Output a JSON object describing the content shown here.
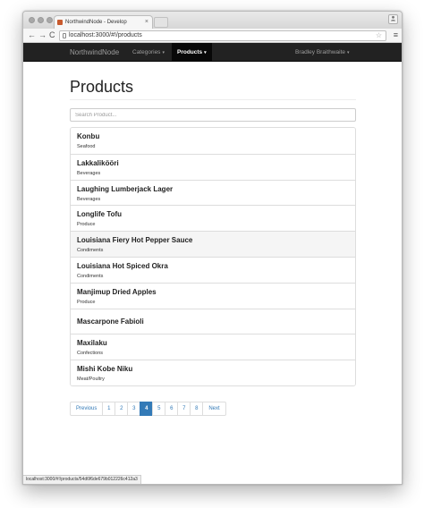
{
  "browser": {
    "tab_title": "NorthwindNode - Develop",
    "tab_close": "×",
    "profile_icon": "person-icon",
    "back": "←",
    "forward": "→",
    "reload": "C",
    "url": "localhost:3000/#!/products",
    "star": "☆",
    "menu": "≡",
    "status_url": "localhost:3000/#!/products/54d6f6de679b012226c412a3"
  },
  "navbar": {
    "brand": "NorthwindNode",
    "categories": "Categories",
    "products": "Products",
    "user": "Bradley Braithwaite",
    "caret": "▾"
  },
  "page": {
    "title": "Products",
    "search_placeholder": "Search Product..."
  },
  "products": [
    {
      "name": "Konbu",
      "category": "Seafood"
    },
    {
      "name": "Lakkalikööri",
      "category": "Beverages"
    },
    {
      "name": "Laughing Lumberjack Lager",
      "category": "Beverages"
    },
    {
      "name": "Longlife Tofu",
      "category": "Produce"
    },
    {
      "name": "Louisiana Fiery Hot Pepper Sauce",
      "category": "Condiments"
    },
    {
      "name": "Louisiana Hot Spiced Okra",
      "category": "Condiments"
    },
    {
      "name": "Manjimup Dried Apples",
      "category": "Produce"
    },
    {
      "name": "Mascarpone Fabioli",
      "category": ""
    },
    {
      "name": "Maxilaku",
      "category": "Confections"
    },
    {
      "name": "Mishi Kobe Niku",
      "category": "Meat/Poultry"
    }
  ],
  "pagination": {
    "previous": "Previous",
    "pages": [
      "1",
      "2",
      "3",
      "4",
      "5",
      "6",
      "7",
      "8"
    ],
    "active": "4",
    "next": "Next"
  }
}
